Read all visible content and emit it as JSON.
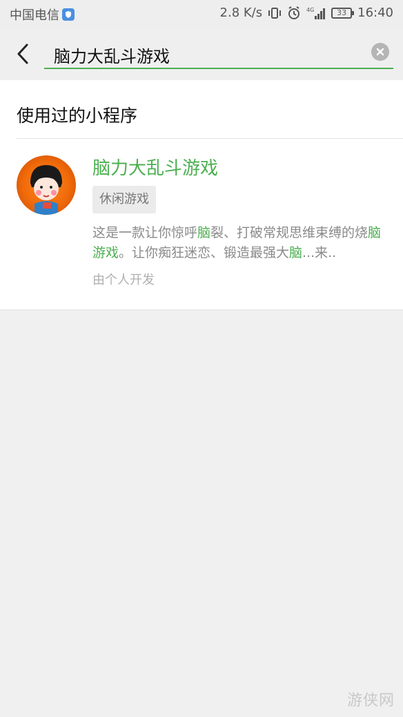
{
  "status_bar": {
    "carrier": "中国电信",
    "speed": "2.8 K/s",
    "network": "4G",
    "battery": "33",
    "time": "16:40"
  },
  "search": {
    "query": "脑力大乱斗游戏"
  },
  "section": {
    "title": "使用过的小程序"
  },
  "result": {
    "title": "脑力大乱斗游戏",
    "tag": "休闲游戏",
    "desc_parts": [
      "这是一款让你惊呼",
      "脑",
      "裂、打破常规思维束缚的烧",
      "脑游戏",
      "。让你痴狂迷恋、锻造最强大",
      "脑",
      "...来.."
    ],
    "developer": "由个人开发"
  },
  "watermark": "游侠网",
  "colors": {
    "accent_green": "#4caf50",
    "background": "#f0f0f0",
    "panel": "#ffffff"
  }
}
